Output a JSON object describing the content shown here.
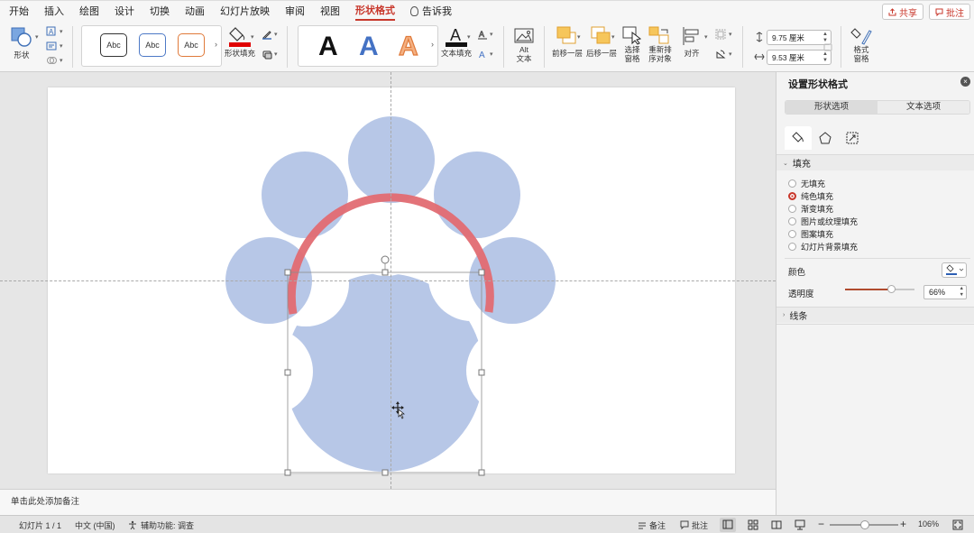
{
  "tabs": [
    "开始",
    "插入",
    "绘图",
    "设计",
    "切换",
    "动画",
    "幻灯片放映",
    "审阅",
    "视图",
    "形状格式"
  ],
  "active_tab": "形状格式",
  "tell_me": "告诉我",
  "share": "共享",
  "comments": "批注",
  "ribbon": {
    "shape": "形状",
    "shape_styles": [
      "Abc",
      "Abc",
      "Abc"
    ],
    "shape_fill": "形状填充",
    "wordart": [
      "A",
      "A",
      "A"
    ],
    "text_fill": "文本填充",
    "alt_text_1": "Alt",
    "alt_text_2": "文本",
    "bring_forward": "前移一层",
    "send_backward": "后移一层",
    "selection_pane_1": "选择",
    "selection_pane_2": "窗格",
    "reorder_1": "重新排",
    "reorder_2": "序对象",
    "align": "对齐",
    "height": "9.75 厘米",
    "width": "9.53 厘米",
    "format_pane_1": "格式",
    "format_pane_2": "窗格"
  },
  "colors": {
    "accent": "#c8372b",
    "shape_fill": "#b7c7e7",
    "arc": "#e16b72",
    "fill_line": "#e00000"
  },
  "panel": {
    "title": "设置形状格式",
    "tab_shape": "形状选项",
    "tab_text": "文本选项",
    "fill_section": "填充",
    "fill_options": [
      "无填充",
      "纯色填充",
      "渐变填充",
      "图片或纹理填充",
      "图案填充",
      "幻灯片背景填充"
    ],
    "selected_fill": 1,
    "color_label": "颜色",
    "transparency_label": "透明度",
    "transparency": "66%",
    "transparency_value": 0.66,
    "line_section": "线条"
  },
  "notes_placeholder": "单击此处添加备注",
  "status": {
    "slide": "幻灯片 1 / 1",
    "language": "中文 (中国)",
    "accessibility": "辅助功能: 调查",
    "notes": "备注",
    "comments": "批注",
    "zoom": "106%"
  }
}
